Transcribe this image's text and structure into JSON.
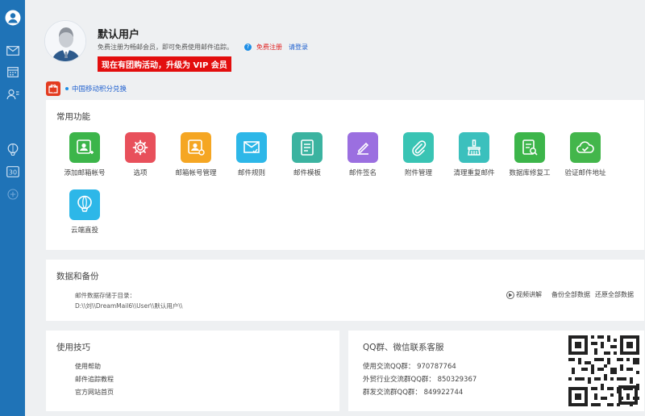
{
  "sidebar": {
    "icons": [
      "user-avatar-icon",
      "mail-icon",
      "calendar-icon",
      "contacts-icon",
      "balloon-icon",
      "calendar-30-icon",
      "add-circle-icon"
    ],
    "badge_30": "30"
  },
  "header": {
    "user_name": "默认用户",
    "subtitle": "免费注册为畅邮会员，即可免费使用邮件追踪。",
    "help_mark": "?",
    "register_link": "免费注册",
    "login_link": "请登录",
    "promo_text": "现在有团购活动，升级为 VIP 会员"
  },
  "gift": {
    "link": "中国移动积分兑换"
  },
  "common": {
    "title": "常用功能",
    "items": [
      {
        "label": "添加邮箱帐号",
        "color": "#3cb54a",
        "icon": "add-account-icon"
      },
      {
        "label": "选项",
        "color": "#e8505b",
        "icon": "gear-icon"
      },
      {
        "label": "邮箱帐号管理",
        "color": "#f5a623",
        "icon": "account-manage-icon"
      },
      {
        "label": "邮件规则",
        "color": "#2db7e8",
        "icon": "mail-rule-icon"
      },
      {
        "label": "邮件模板",
        "color": "#3bb3a0",
        "icon": "template-icon"
      },
      {
        "label": "邮件签名",
        "color": "#9b6fe0",
        "icon": "pen-icon"
      },
      {
        "label": "附件管理",
        "color": "#39c4b4",
        "icon": "paperclip-icon"
      },
      {
        "label": "清理重复邮件",
        "color": "#3bc0bd",
        "icon": "broom-icon"
      },
      {
        "label": "数据库修复工",
        "color": "#3cb54a",
        "icon": "db-repair-icon"
      },
      {
        "label": "验证邮件地址",
        "color": "#43b64b",
        "icon": "cloud-check-icon"
      },
      {
        "label": "云端直投",
        "color": "#2db7e8",
        "icon": "balloon-icon"
      }
    ]
  },
  "data_backup": {
    "title": "数据和备份",
    "storage_label": "邮件数据存储于目录：",
    "storage_path": "D:\\\\刘\\\\DreamMail6\\\\User\\\\默认用户\\\\",
    "video_label": "视频讲解",
    "backup_all": "备份全部数据",
    "restore_all": "还原全部数据"
  },
  "tips": {
    "title": "使用技巧",
    "items": [
      "使用帮助",
      "邮件追踪教程",
      "官方网站首页"
    ]
  },
  "qq": {
    "title": "QQ群、微信联系客服",
    "lines": [
      "使用交流QQ群：  970787764",
      "外贸行业交流群QQ群：  850329367",
      "群发交流群QQ群：  849922744"
    ]
  },
  "colors": {
    "sidebar": "#1f73b7",
    "promo": "#e30e0e",
    "link_blue": "#1e5fcf",
    "register_red": "#e02020"
  }
}
